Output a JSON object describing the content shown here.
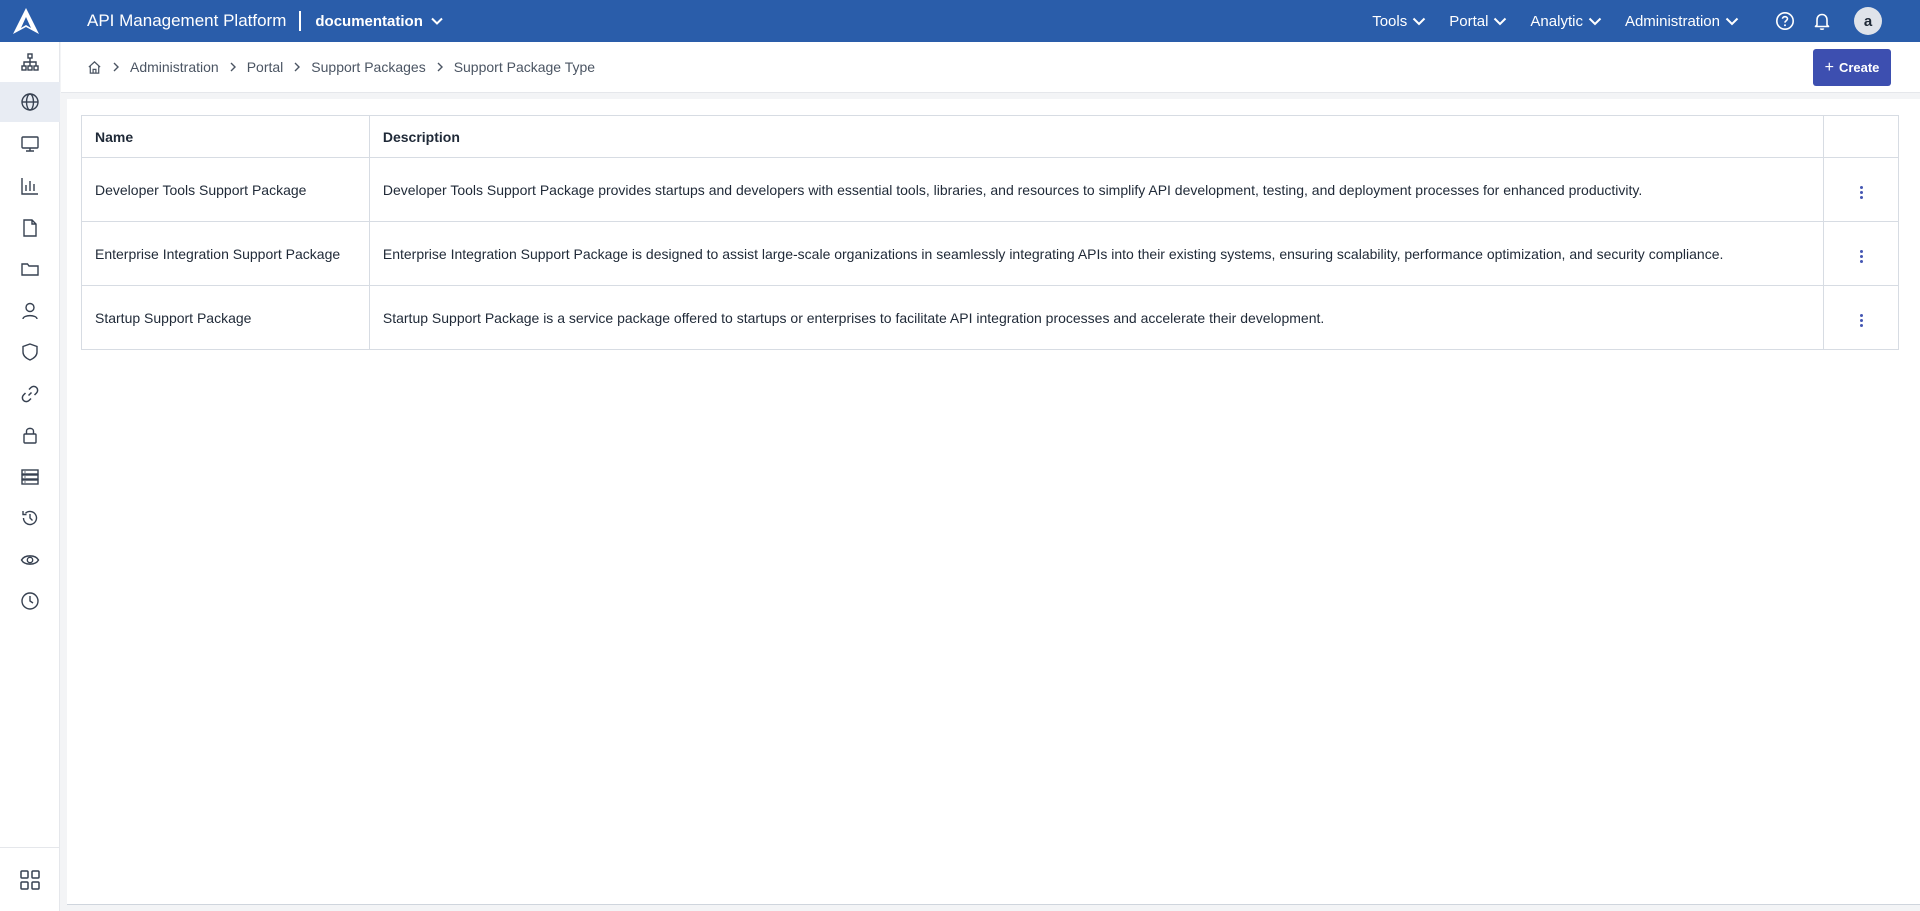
{
  "header": {
    "app_title": "API Management Platform",
    "org": "documentation",
    "nav": [
      {
        "label": "Tools"
      },
      {
        "label": "Portal"
      },
      {
        "label": "Analytic"
      },
      {
        "label": "Administration"
      }
    ],
    "avatar_initial": "a"
  },
  "sidebar": {
    "items": [
      {
        "icon": "sitemap-icon"
      },
      {
        "icon": "globe-icon",
        "active": true
      },
      {
        "icon": "monitor-icon"
      },
      {
        "icon": "bar-chart-icon"
      },
      {
        "icon": "file-icon"
      },
      {
        "icon": "folder-icon"
      },
      {
        "icon": "user-icon"
      },
      {
        "icon": "shield-icon"
      },
      {
        "icon": "link-icon"
      },
      {
        "icon": "lock-icon"
      },
      {
        "icon": "server-icon"
      },
      {
        "icon": "history-icon"
      },
      {
        "icon": "eye-icon"
      },
      {
        "icon": "clock-icon"
      }
    ],
    "bottom_icon": "apps-grid-icon"
  },
  "breadcrumb": {
    "items": [
      "Administration",
      "Portal",
      "Support Packages",
      "Support Package Type"
    ]
  },
  "toolbar": {
    "create_label": "Create"
  },
  "table": {
    "columns": [
      "Name",
      "Description",
      ""
    ],
    "rows": [
      {
        "name": "Developer Tools Support Package",
        "description": "Developer Tools Support Package provides startups and developers with essential tools, libraries, and resources to simplify API development, testing, and deployment processes for enhanced productivity."
      },
      {
        "name": "Enterprise Integration Support Package",
        "description": "Enterprise Integration Support Package is designed to assist large-scale organizations in seamlessly integrating APIs into their existing systems, ensuring scalability, performance optimization, and security compliance."
      },
      {
        "name": "Startup Support Package",
        "description": "Startup Support Package is a service package offered to startups or enterprises to facilitate API integration processes and accelerate their development."
      }
    ]
  },
  "colors": {
    "header_bg": "#2a5daa",
    "primary_button": "#3d4fb0",
    "kebab": "#4557b3"
  }
}
